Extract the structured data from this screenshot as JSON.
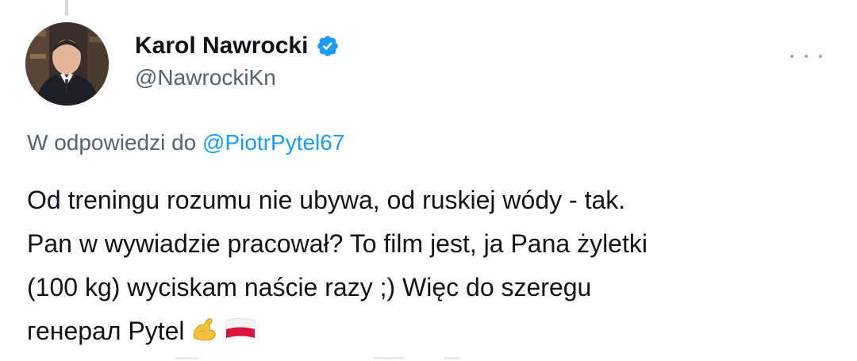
{
  "author": {
    "display_name": "Karol Nawrocki",
    "handle": "@NawrockiKn",
    "verified": true,
    "avatar_icon": "profile-photo"
  },
  "reply": {
    "prefix": "W odpowiedzi do",
    "to_handle": "@PiotrPytel67"
  },
  "tweet": {
    "lines": [
      "Od treningu rozumu nie ubywa, od ruskiej wódy - tak.",
      "Pan w wywiadzie pracował? To film jest, ja Pana żyletki",
      "(100 kg) wyciskam naście razy ;) Więc do szeregu",
      "генерал Pytel"
    ],
    "emojis": [
      "flexed-biceps-icon",
      "poland-flag-icon"
    ]
  },
  "colors": {
    "text": "#0f1419",
    "secondary": "#536471",
    "link": "#1d9bf0",
    "verified": "#1d9bf0"
  }
}
